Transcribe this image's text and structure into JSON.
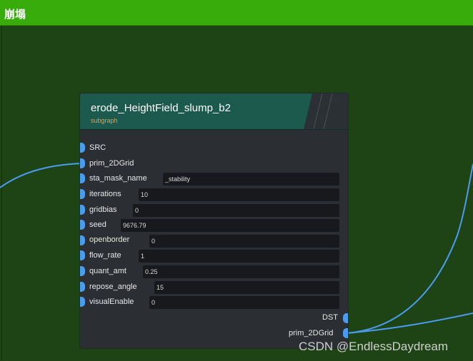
{
  "window": {
    "title": "崩塌"
  },
  "node": {
    "title": "erode_HeightField_slump_b2",
    "subtitle": "subgraph",
    "inputs": [
      {
        "label": "SRC"
      },
      {
        "label": "prim_2DGrid"
      },
      {
        "label": "sta_mask_name",
        "value": "_stability"
      },
      {
        "label": "iterations",
        "value": "10"
      },
      {
        "label": "gridbias",
        "value": "0"
      },
      {
        "label": "seed",
        "value": "9676.79"
      },
      {
        "label": "openborder",
        "value": "0"
      },
      {
        "label": "flow_rate",
        "value": "1"
      },
      {
        "label": "quant_amt",
        "value": "0.25"
      },
      {
        "label": "repose_angle",
        "value": "15"
      },
      {
        "label": "visualEnable",
        "value": "0"
      }
    ],
    "outputs": [
      {
        "label": "DST"
      },
      {
        "label": "prim_2DGrid"
      }
    ]
  },
  "colors": {
    "title_bar": "#37ac0a",
    "canvas": "#1e4314",
    "node_body": "#2b2e33",
    "node_header": "#1c5a4d",
    "socket": "#4a9cf0",
    "wire": "#4a9cf0"
  },
  "watermark": "CSDN @EndlessDaydream"
}
